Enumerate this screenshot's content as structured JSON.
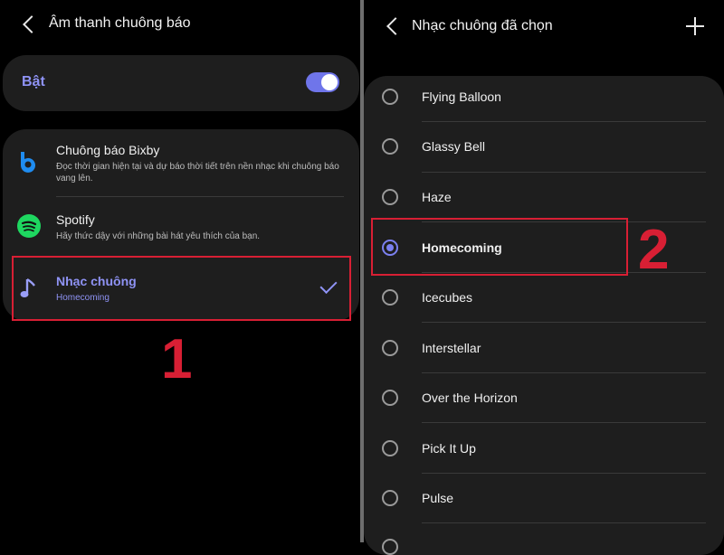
{
  "left": {
    "title": "Âm thanh chuông báo",
    "master": {
      "label": "Bật",
      "enabled": true
    },
    "options": [
      {
        "title": "Chuông báo Bixby",
        "desc": "Đọc thời gian hiện tại và dự báo thời tiết trên nền nhạc khi chuông báo vang lên.",
        "icon": "bixby-icon"
      },
      {
        "title": "Spotify",
        "desc": "Hãy thức dậy với những bài hát yêu thích của bạn.",
        "icon": "spotify-icon"
      },
      {
        "title": "Nhạc chuông",
        "desc": "Homecoming",
        "icon": "music-note-icon",
        "selected": true
      }
    ],
    "step_label": "1"
  },
  "right": {
    "title": "Nhạc chuông đã chọn",
    "ringtones": [
      "Flying Balloon",
      "Glassy Bell",
      "Haze",
      "Homecoming",
      "Icecubes",
      "Interstellar",
      "Over the Horizon",
      "Pick It Up",
      "Pulse"
    ],
    "selected": "Homecoming",
    "step_label": "2"
  },
  "colors": {
    "accent": "#8f93f5",
    "annotation": "#d81f34",
    "card": "#1e1e1e",
    "background": "#000000"
  }
}
